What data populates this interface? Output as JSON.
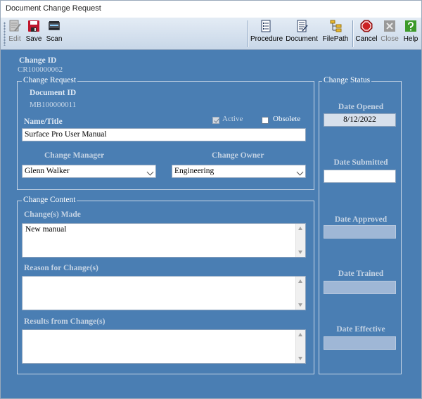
{
  "window": {
    "title": "Document Change Request"
  },
  "toolbar": {
    "left": [
      {
        "label": "Edit",
        "icon": "edit-icon",
        "enabled": false
      },
      {
        "label": "Save",
        "icon": "save-icon",
        "enabled": true
      },
      {
        "label": "Scan",
        "icon": "scanner-icon",
        "enabled": true
      }
    ],
    "right": [
      {
        "label": "Procedure",
        "icon": "procedure-icon",
        "enabled": true
      },
      {
        "label": "Document",
        "icon": "document-icon",
        "enabled": true
      },
      {
        "label": "FilePath",
        "icon": "filepath-icon",
        "enabled": true
      },
      {
        "label": "Cancel",
        "icon": "cancel-icon",
        "enabled": true
      },
      {
        "label": "Close",
        "icon": "close-icon",
        "enabled": false
      },
      {
        "label": "Help",
        "icon": "help-icon",
        "enabled": true
      }
    ]
  },
  "change": {
    "id_label": "Change ID",
    "id_value": "CR100000062"
  },
  "request": {
    "title": "Change Request",
    "doc_id_label": "Document ID",
    "doc_id_value": "MB100000011",
    "name_label": "Name/Title",
    "name_value": "Surface Pro User Manual",
    "active_label": "Active",
    "active_checked": true,
    "obsolete_label": "Obsolete",
    "obsolete_checked": false,
    "manager_label": "Change Manager",
    "manager_value": "Glenn Walker",
    "owner_label": "Change Owner",
    "owner_value": "Engineering"
  },
  "content": {
    "title": "Change Content",
    "made_label": "Change(s) Made",
    "made_value": "New manual",
    "reason_label": "Reason for Change(s)",
    "reason_value": "",
    "results_label": "Results from Change(s)",
    "results_value": ""
  },
  "status": {
    "title": "Change Status",
    "opened_label": "Date Opened",
    "opened_value": "8/12/2022",
    "submitted_label": "Date Submitted",
    "submitted_value": "",
    "approved_label": "Date Approved",
    "approved_value": "",
    "trained_label": "Date Trained",
    "trained_value": "",
    "effective_label": "Date Effective",
    "effective_value": ""
  },
  "colors": {
    "background": "#4a7eb3",
    "cancel_red": "#cc2222",
    "help_green": "#3c9a2a"
  }
}
